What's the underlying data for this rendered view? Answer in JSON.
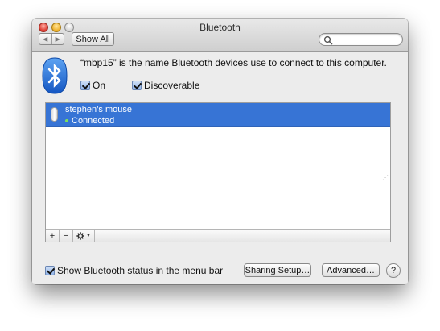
{
  "window": {
    "title": "Bluetooth"
  },
  "toolbar": {
    "back_icon": "◀",
    "forward_icon": "▶",
    "show_all_label": "Show All",
    "search_placeholder": "",
    "search_value": ""
  },
  "header": {
    "info_text": "“mbp15” is the name Bluetooth devices use to connect to this computer.",
    "on_label": "On",
    "on_checked": true,
    "discoverable_label": "Discoverable",
    "discoverable_checked": true
  },
  "devices": [
    {
      "name": "stephen’s mouse",
      "status": "Connected",
      "status_color": "#7ee05b",
      "selected": true,
      "icon": "mouse-icon"
    }
  ],
  "list_toolbar": {
    "add_label": "+",
    "remove_label": "−",
    "action_icon": "gear-icon",
    "action_caret": "▼"
  },
  "footer": {
    "show_status_label": "Show Bluetooth status in the menu bar",
    "show_status_checked": true,
    "sharing_setup_label": "Sharing Setup…",
    "advanced_label": "Advanced…",
    "help_label": "?"
  },
  "colors": {
    "selection": "#3774d5",
    "bluetooth_logo": "#1f6ed6"
  }
}
